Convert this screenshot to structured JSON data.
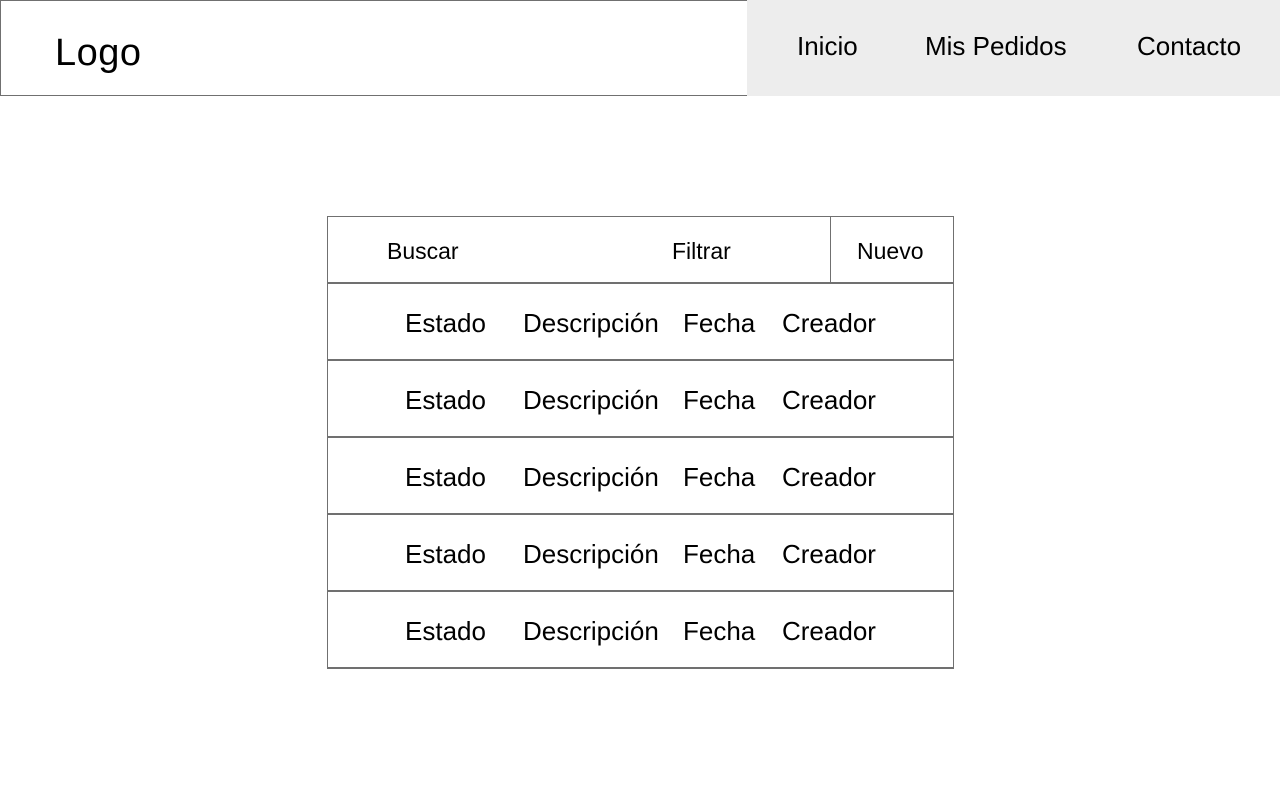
{
  "header": {
    "logo": "Logo",
    "nav": [
      "Inicio",
      "Mis Pedidos",
      "Contacto"
    ]
  },
  "toolbar": {
    "search_label": "Buscar",
    "filter_label": "Filtrar",
    "new_label": "Nuevo"
  },
  "table": {
    "rows": [
      {
        "estado": "Estado",
        "descripcion": "Descripción",
        "fecha": "Fecha",
        "creador": "Creador"
      },
      {
        "estado": "Estado",
        "descripcion": "Descripción",
        "fecha": "Fecha",
        "creador": "Creador"
      },
      {
        "estado": "Estado",
        "descripcion": "Descripción",
        "fecha": "Fecha",
        "creador": "Creador"
      },
      {
        "estado": "Estado",
        "descripcion": "Descripción",
        "fecha": "Fecha",
        "creador": "Creador"
      },
      {
        "estado": "Estado",
        "descripcion": "Descripción",
        "fecha": "Fecha",
        "creador": "Creador"
      }
    ]
  },
  "colors": {
    "nav_background": "#ededed",
    "border": "#707070"
  }
}
